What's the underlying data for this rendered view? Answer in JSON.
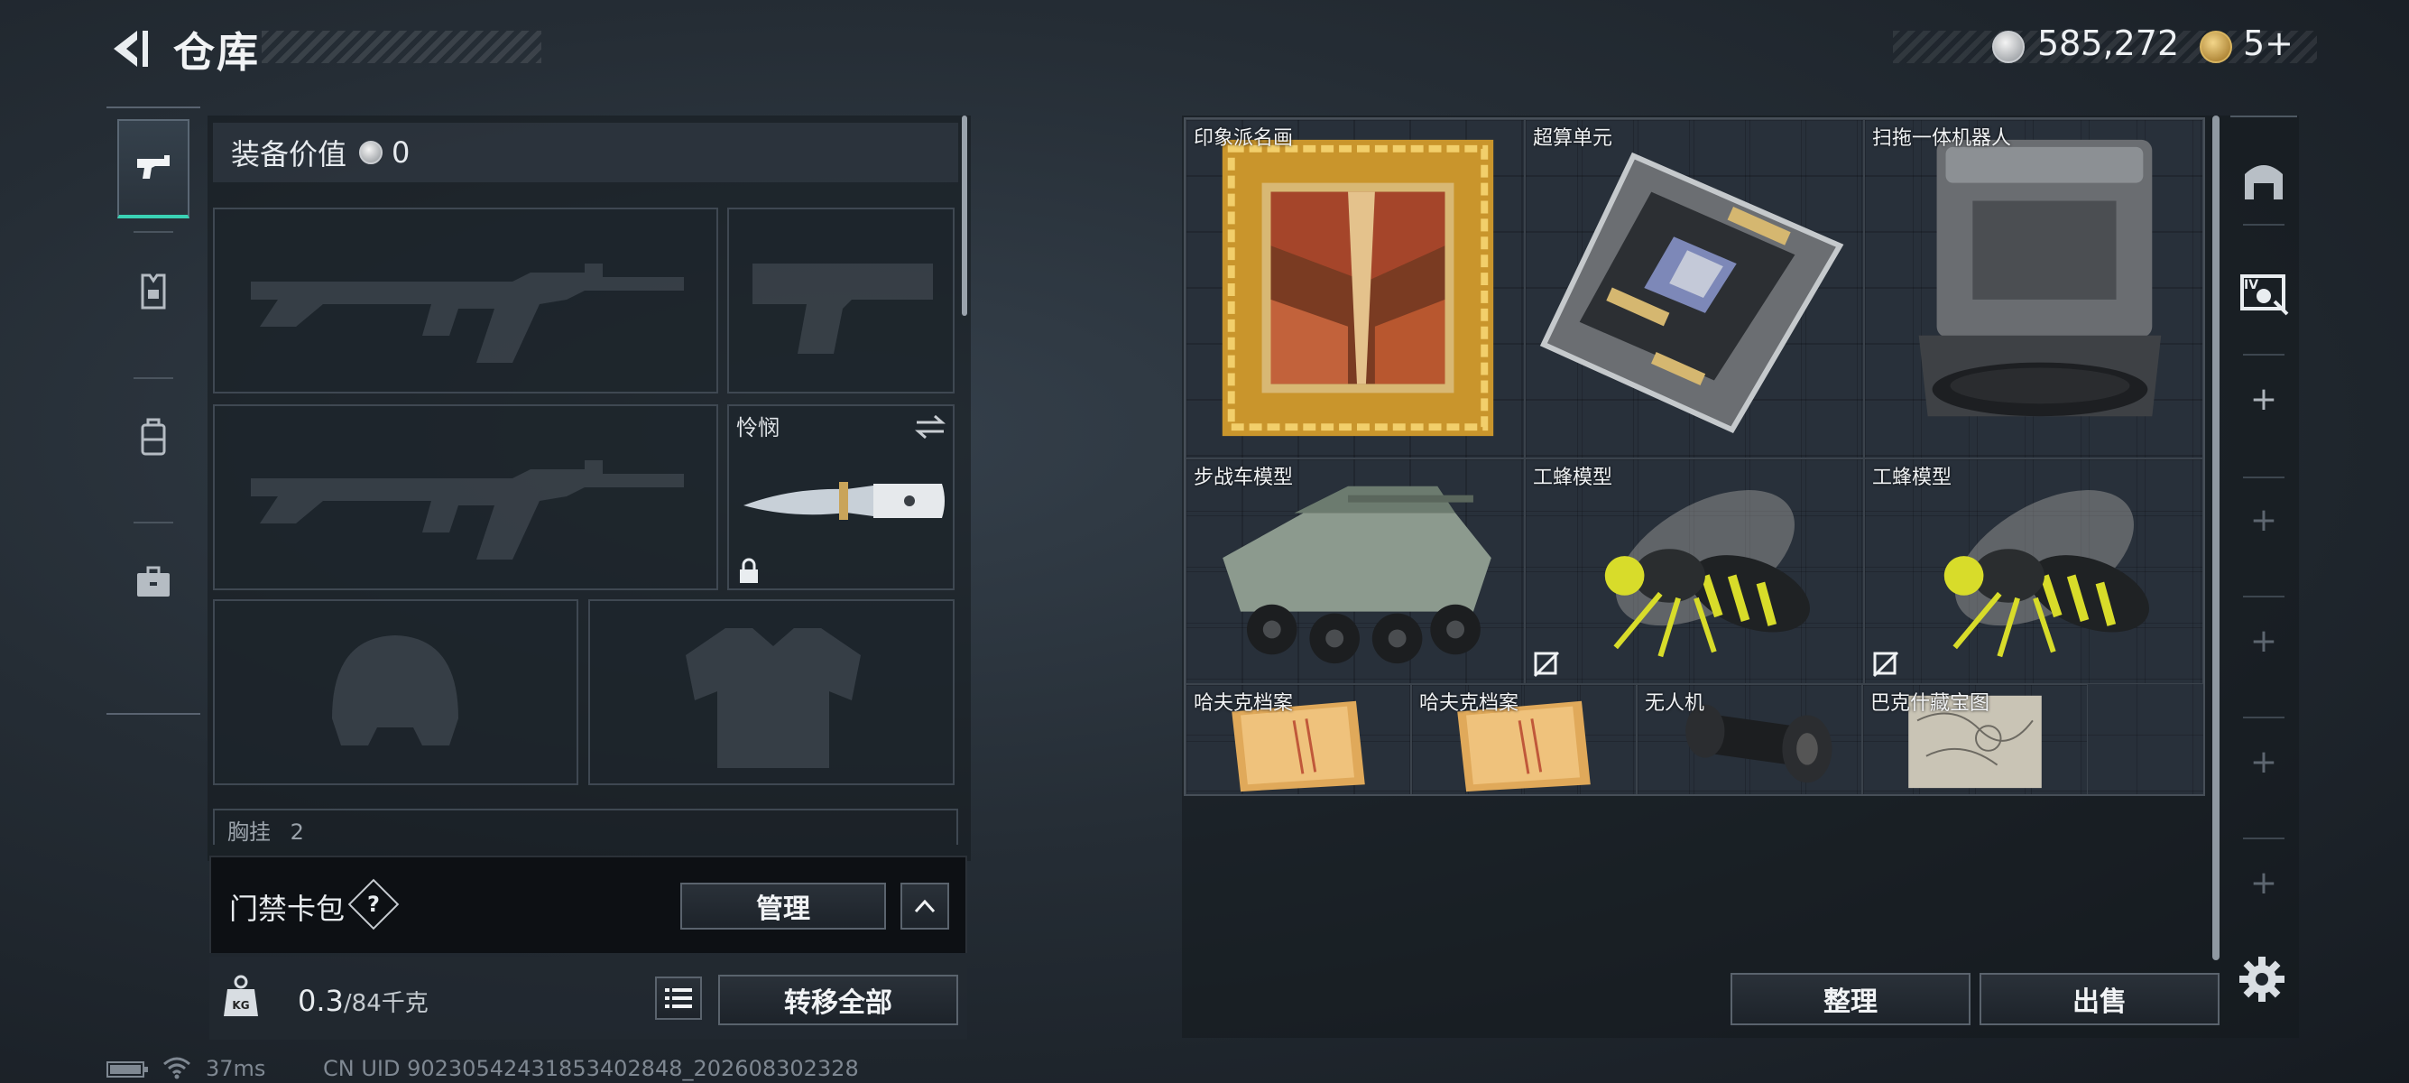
{
  "header": {
    "title": "仓库"
  },
  "currency": {
    "silver": "585,272",
    "gold": "5+"
  },
  "equipment": {
    "value_label": "装备价值",
    "value": "0",
    "melee_label": "怜悯",
    "chest_rig_label": "胸挂",
    "chest_rig_extra": "2"
  },
  "keycard": {
    "label": "门禁卡包",
    "help": "?",
    "manage": "管理"
  },
  "capacity": {
    "current": "0.3",
    "max": "/84千克",
    "transfer_all": "转移全部",
    "kg": "KG"
  },
  "status": {
    "ping": "37ms",
    "uid": "CN UID 90230542431853402848_202608302328"
  },
  "storage": {
    "items": [
      {
        "name": "印象派名画",
        "bg": "#44202a",
        "icon": "framed-painting-icon"
      },
      {
        "name": "超算单元",
        "bg": "#44202a",
        "icon": "compute-unit-icon"
      },
      {
        "name": "扫拖一体机器人",
        "bg": "#44202a",
        "icon": "robot-vacuum-icon"
      },
      {
        "name": "步战车模型",
        "bg": "#44202a",
        "icon": "ifv-model-icon"
      },
      {
        "name": "工蜂模型",
        "bg": "#463429",
        "icon": "wasp-model-icon"
      },
      {
        "name": "工蜂模型",
        "bg": "#463429",
        "icon": "wasp-model-icon"
      },
      {
        "name": "哈夫克档案",
        "bg": "#463429",
        "icon": "folder-icon"
      },
      {
        "name": "哈夫克档案",
        "bg": "#463429",
        "icon": "folder-icon"
      },
      {
        "name": "无人机",
        "bg": "#44202a",
        "icon": "drone-part-icon"
      },
      {
        "name": "巴克什藏宝图",
        "bg": "#463429",
        "icon": "treasure-map-icon"
      }
    ],
    "sort_button": "整理",
    "sell_button": "出售"
  }
}
